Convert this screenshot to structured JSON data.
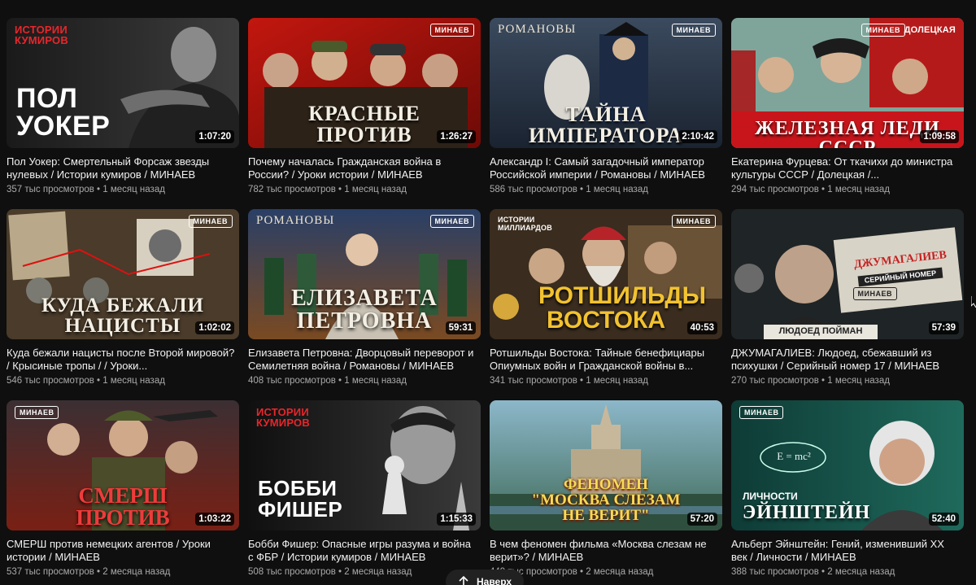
{
  "videos": [
    {
      "title": "Пол Уокер: Смертельный Форсаж звезды нулевых / Истории кумиров / МИНАЕВ",
      "views": "357 тыс просмотров",
      "age": "1 месяц назад",
      "duration": "1:07:20",
      "thumb": {
        "brand": "ИСТОРИИ КУМИРОВ",
        "headline": "ПОЛ УОКЕР"
      }
    },
    {
      "title": "Почему началась Гражданская война в России? / Уроки истории / МИНАЕВ",
      "views": "782 тыс просмотров",
      "age": "1 месяц назад",
      "duration": "1:26:27",
      "thumb": {
        "badge": "МИНАЕВ",
        "headline": "КРАСНЫЕ ПРОТИВ БЕЛЫХ"
      }
    },
    {
      "title": "Александр I: Самый загадочный император Российской империи / Романовы / МИНАЕВ",
      "views": "586 тыс просмотров",
      "age": "1 месяц назад",
      "duration": "2:10:42",
      "thumb": {
        "brand": "РОМАНОВЫ",
        "badge": "МИНАЕВ",
        "headline": "ТАЙНА ИМПЕРАТОРА АЛЕКСАНДРА I"
      }
    },
    {
      "title": "Екатерина Фурцева: От ткачихи до министра культуры СССР / Долецкая /...",
      "views": "294 тыс просмотров",
      "age": "1 месяц назад",
      "duration": "1:09:58",
      "thumb": {
        "badge": "МИНАЕВ",
        "brand": "ДОЛЕЦКАЯ",
        "headline": "ЖЕЛЕЗНАЯ ЛЕДИ СССР"
      }
    },
    {
      "title": "Куда бежали нацисты после Второй мировой? / Крысиные тропы / / Уроки...",
      "views": "546 тыс просмотров",
      "age": "1 месяц назад",
      "duration": "1:02:02",
      "thumb": {
        "badge": "МИНАЕВ",
        "headline": "КУДА БЕЖАЛИ НАЦИСТЫ"
      }
    },
    {
      "title": "Елизавета Петровна: Дворцовый переворот и Семилетняя война / Романовы / МИНАЕВ",
      "views": "408 тыс просмотров",
      "age": "1 месяц назад",
      "duration": "59:31",
      "thumb": {
        "brand": "РОМАНОВЫ",
        "badge": "МИНАЕВ",
        "headline": "ЕЛИЗАВЕТА ПЕТРОВНА"
      }
    },
    {
      "title": "Ротшильды Востока: Тайные бенефициары Опиумных войн и Гражданской войны в...",
      "views": "341 тыс просмотров",
      "age": "1 месяц назад",
      "duration": "40:53",
      "thumb": {
        "brand": "ИСТОРИИ МИЛЛИАРДОВ",
        "badge": "МИНАЕВ",
        "headline": "РОТШИЛЬДЫ ВОСТОКА"
      }
    },
    {
      "title": "ДЖУМАГАЛИЕВ: Людоед, сбежавший из психушки / Серийный номер 17 / МИНАЕВ",
      "views": "270 тыс просмотров",
      "age": "1 месяц назад",
      "duration": "57:39",
      "thumb": {
        "headline": "ДЖУМАГАЛИЕВ",
        "subheadline": "СЕРИЙНЫЙ НОМЕР",
        "badge": "МИНАЕВ",
        "strip": "ЛЮДОЕД ПОЙМАН"
      }
    },
    {
      "title": "СМЕРШ против немецких агентов / Уроки истории / МИНАЕВ",
      "views": "537 тыс просмотров",
      "age": "2 месяца назад",
      "duration": "1:03:22",
      "thumb": {
        "badge": "МИНАЕВ",
        "headline": "СМЕРШ ПРОТИВ АБВЕРА"
      }
    },
    {
      "title": "Бобби Фишер: Опасные игры разума и война с ФБР / Истории кумиров / МИНАЕВ",
      "views": "508 тыс просмотров",
      "age": "2 месяца назад",
      "duration": "1:15:33",
      "thumb": {
        "brand": "ИСТОРИИ КУМИРОВ",
        "headline": "БОББИ ФИШЕР"
      }
    },
    {
      "title": "В чем феномен фильма «Москва слезам не верит»? / МИНАЕВ",
      "views": "449 тыс просмотров",
      "age": "2 месяца назад",
      "duration": "57:20",
      "thumb": {
        "headline": "ФЕНОМЕН \"МОСКВА СЛЕЗАМ НЕ ВЕРИТ\""
      }
    },
    {
      "title": "Альберт Эйнштейн: Гений, изменивший XX век / Личности / МИНАЕВ",
      "views": "388 тыс просмотров",
      "age": "2 месяца назад",
      "duration": "52:40",
      "thumb": {
        "badge": "МИНАЕВ",
        "kicker": "ЛИЧНОСТИ",
        "headline": "ЭЙНШТЕЙН",
        "formula": "E = mc²"
      }
    }
  ],
  "scroll_top": {
    "label": "Наверх",
    "icon": "arrow-up-icon"
  },
  "colors": {
    "background": "#0f0f0f",
    "meta": "#aaaaaa",
    "brand_red": "#e8262b"
  }
}
